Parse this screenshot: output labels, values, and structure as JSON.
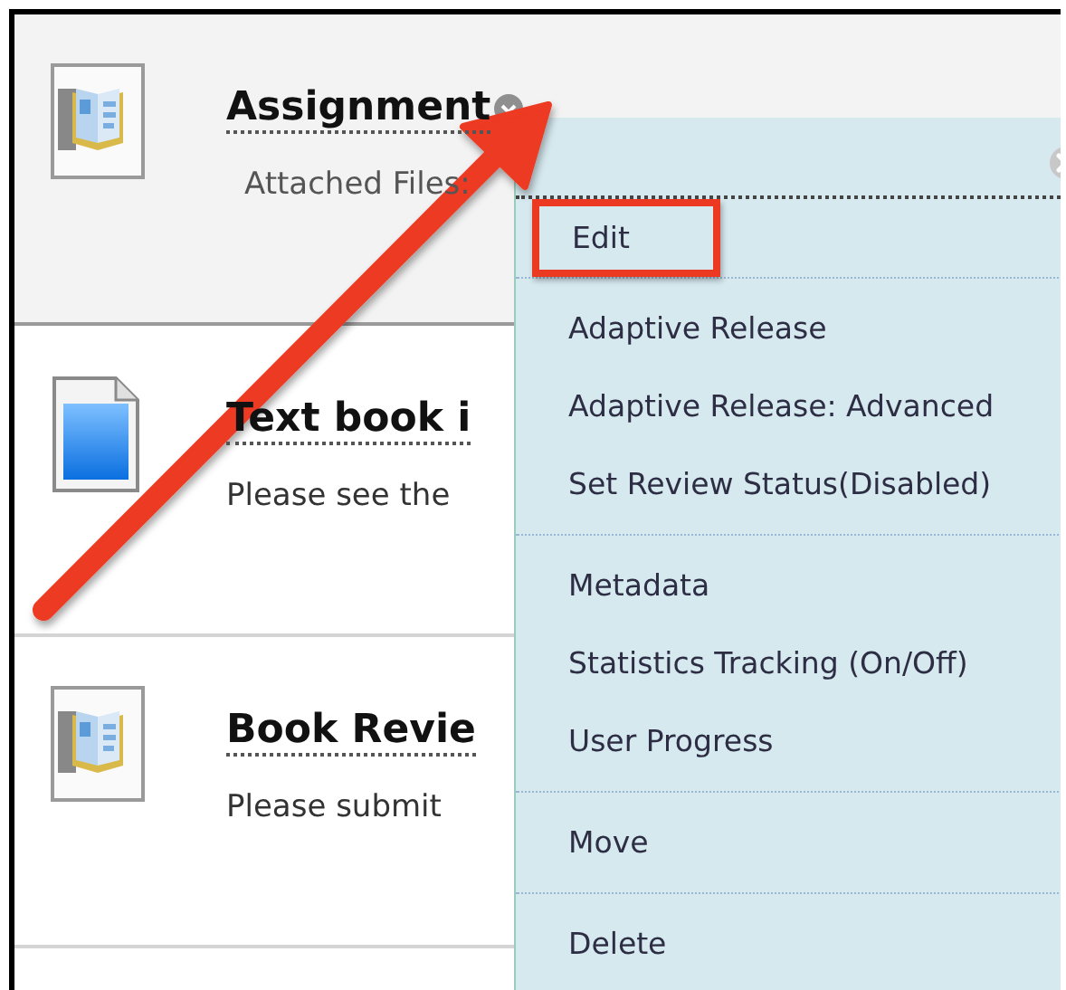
{
  "content_items": [
    {
      "kind": "assignment",
      "title": "Assignment",
      "description": "Attached Files:",
      "selected": true
    },
    {
      "kind": "document",
      "title": "Text book i",
      "description": "Please see the",
      "selected": false
    },
    {
      "kind": "assignment",
      "title": "Book Revie",
      "description": "Please submit",
      "selected": false
    }
  ],
  "context_menu": {
    "groups": [
      {
        "items": [
          {
            "label": "Edit",
            "highlighted": true
          }
        ]
      },
      {
        "items": [
          {
            "label": "Adaptive Release",
            "highlighted": false
          },
          {
            "label": "Adaptive Release: Advanced",
            "highlighted": false
          },
          {
            "label": "Set Review Status(Disabled)",
            "highlighted": false
          }
        ]
      },
      {
        "items": [
          {
            "label": "Metadata",
            "highlighted": false
          },
          {
            "label": "Statistics Tracking (On/Off)",
            "highlighted": false
          },
          {
            "label": "User Progress",
            "highlighted": false
          }
        ]
      },
      {
        "items": [
          {
            "label": "Move",
            "highlighted": false
          }
        ]
      },
      {
        "items": [
          {
            "label": "Delete",
            "highlighted": false
          }
        ]
      }
    ]
  }
}
